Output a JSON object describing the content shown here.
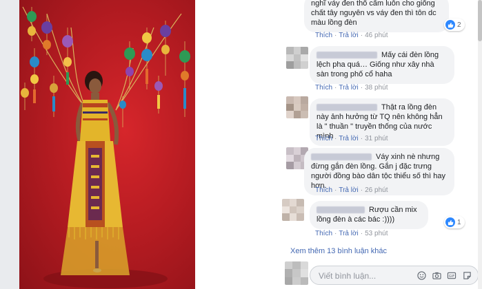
{
  "comments": [
    {
      "text": "nghĩ váy đen thổ cẩm luôn cho giống chất tây nguyên vs váy đen thì tôn dc màu lồng đèn",
      "like": "Thích",
      "reply": "Trả lời",
      "time": "46 phút",
      "reactions": "2"
    },
    {
      "text": "Mấy cái đèn lồng lệch pha quá… Giống như xây nhà sàn trong phố cổ haha",
      "like": "Thích",
      "reply": "Trả lời",
      "time": "38 phút"
    },
    {
      "text": "Thật ra lồng đèn này ảnh hưởng từ TQ nên không hẳn là \" thuần \" truyền thống của nước mình",
      "like": "Thích",
      "reply": "Trả lời",
      "time": "31 phút"
    },
    {
      "text": "Váy xinh nè nhưng đừng gắn đèn lồng. Gắn j đặc trưng người đồng bào dân tộc thiểu số thì hay hơn.",
      "like": "Thích",
      "reply": "Trả lời",
      "time": "26 phút"
    },
    {
      "text": "Rượu cần mix lồng đèn à các bác :))))",
      "like": "Thích",
      "reply": "Trả lời",
      "time": "53 phút",
      "reactions": "1"
    }
  ],
  "more_comments": "Xem thêm 13 bình luận khác",
  "composer": {
    "placeholder": "Viết bình luận..."
  },
  "colors": {
    "link": "#4267b2",
    "bubble": "#f2f3f5",
    "like_blue": "#2d88ff",
    "photo_red": "#c41e24"
  }
}
